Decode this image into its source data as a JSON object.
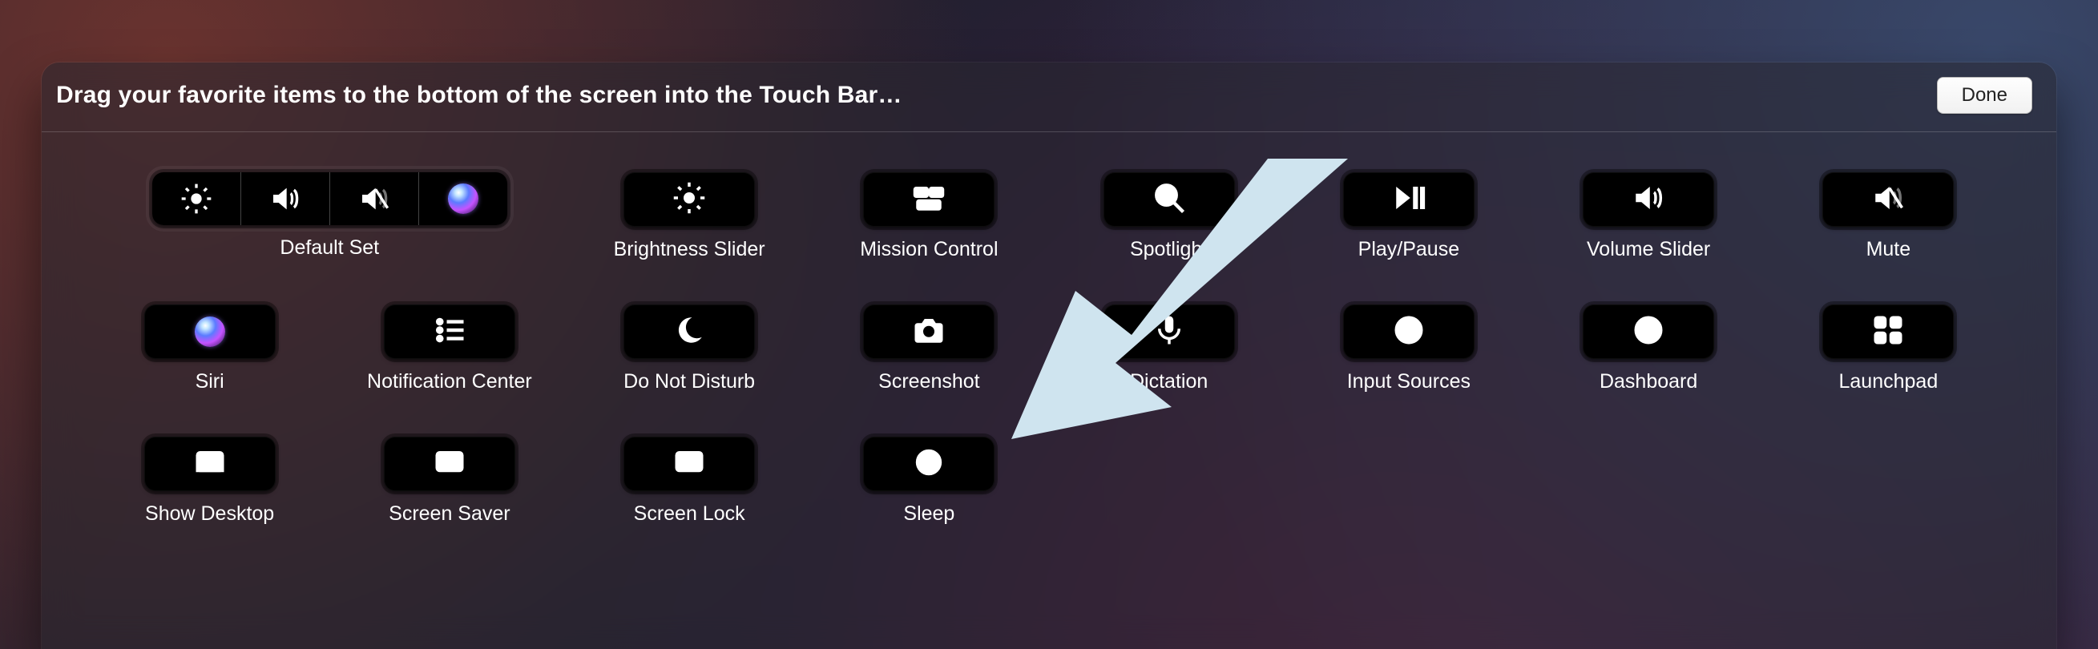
{
  "header": {
    "title": "Drag your favorite items to the bottom of the screen into the Touch Bar…",
    "done": "Done"
  },
  "defaultSet": {
    "label": "Default Set"
  },
  "row1": [
    {
      "id": "brightness-slider",
      "label": "Brightness Slider",
      "icon": "brightness"
    },
    {
      "id": "mission-control",
      "label": "Mission Control",
      "icon": "mission"
    },
    {
      "id": "spotlight",
      "label": "Spotlight",
      "icon": "search"
    },
    {
      "id": "play-pause",
      "label": "Play/Pause",
      "icon": "playpause"
    },
    {
      "id": "volume-slider",
      "label": "Volume Slider",
      "icon": "volume"
    },
    {
      "id": "mute",
      "label": "Mute",
      "icon": "mute"
    }
  ],
  "row2": [
    {
      "id": "siri",
      "label": "Siri",
      "icon": "siri"
    },
    {
      "id": "notification-center",
      "label": "Notification Center",
      "icon": "notif"
    },
    {
      "id": "do-not-disturb",
      "label": "Do Not Disturb",
      "icon": "dnd"
    },
    {
      "id": "screenshot",
      "label": "Screenshot",
      "icon": "camera"
    },
    {
      "id": "dictation",
      "label": "Dictation",
      "icon": "mic"
    },
    {
      "id": "input-sources",
      "label": "Input Sources",
      "icon": "globe"
    },
    {
      "id": "dashboard",
      "label": "Dashboard",
      "icon": "gauge"
    },
    {
      "id": "launchpad",
      "label": "Launchpad",
      "icon": "grid"
    }
  ],
  "row3": [
    {
      "id": "show-desktop",
      "label": "Show Desktop",
      "icon": "desktop"
    },
    {
      "id": "screen-saver",
      "label": "Screen Saver",
      "icon": "screensaver"
    },
    {
      "id": "screen-lock",
      "label": "Screen Lock",
      "icon": "lock"
    },
    {
      "id": "sleep",
      "label": "Sleep",
      "icon": "sleep"
    }
  ],
  "colors": {
    "arrow": "#cfe4ef"
  }
}
